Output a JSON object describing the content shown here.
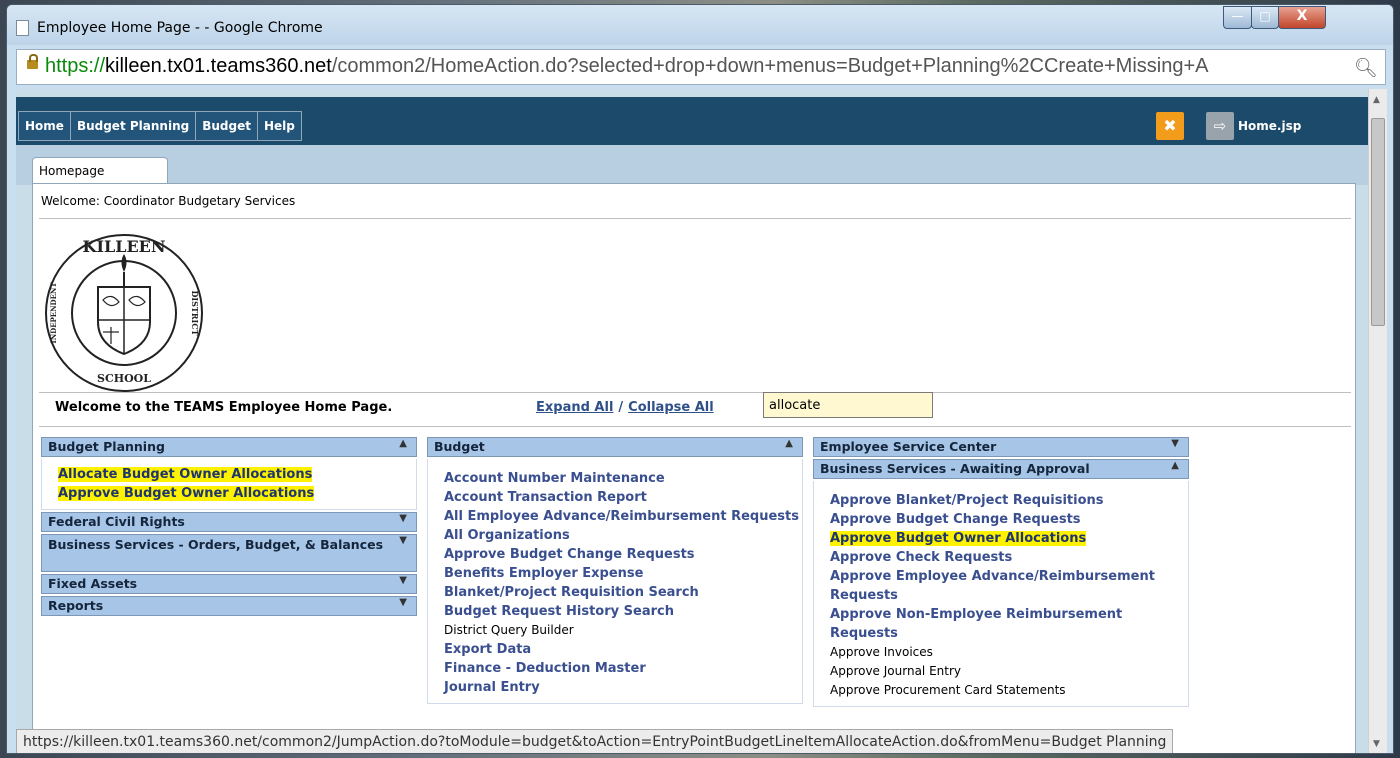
{
  "window": {
    "title": "Employee Home Page - - Google Chrome",
    "minimize": "—",
    "maximize": "□",
    "close": "X"
  },
  "address": {
    "scheme": "https://",
    "host": "killeen.tx01.teams360.net",
    "path": "/common2/HomeAction.do?selected+drop+down+menus=Budget+Planning%2CCreate+Missing+A"
  },
  "nav": {
    "menu": [
      "Home",
      "Budget Planning",
      "Budget",
      "Help"
    ],
    "close_glyph": "✖",
    "exit_glyph": "⇨",
    "page_name": "Home.jsp"
  },
  "tab": {
    "label": "Homepage"
  },
  "page": {
    "welcome": "Welcome: Coordinator Budgetary Services",
    "lead": "Welcome to the TEAMS Employee Home Page.",
    "expand_all": "Expand All",
    "separator": "/",
    "collapse_all": "Collapse All",
    "filter_value": "allocate"
  },
  "columns": [
    {
      "sections": [
        {
          "title": "Budget Planning",
          "expanded": true,
          "items": [
            {
              "label": "Allocate Budget Owner Allocations",
              "highlight": true
            },
            {
              "label": "Approve Budget Owner Allocations",
              "highlight": true
            }
          ]
        },
        {
          "title": "Federal Civil Rights",
          "expanded": false
        },
        {
          "title": "Business Services - Orders, Budget, & Balances",
          "expanded": false
        },
        {
          "title": "Fixed Assets",
          "expanded": false
        },
        {
          "title": "Reports",
          "expanded": false
        }
      ]
    },
    {
      "sections": [
        {
          "title": "Budget",
          "expanded": true,
          "items": [
            {
              "label": "Account Number Maintenance"
            },
            {
              "label": "Account Transaction Report"
            },
            {
              "label": "All Employee Advance/Reimbursement Requests"
            },
            {
              "label": "All Organizations"
            },
            {
              "label": "Approve Budget Change Requests"
            },
            {
              "label": "Benefits Employer Expense"
            },
            {
              "label": "Blanket/Project Requisition Search"
            },
            {
              "label": "Budget Request History Search"
            },
            {
              "label": "District Query Builder",
              "plain": true
            },
            {
              "label": "Export Data"
            },
            {
              "label": "Finance - Deduction Master"
            },
            {
              "label": "Journal Entry"
            }
          ]
        }
      ]
    },
    {
      "sections": [
        {
          "title": "Employee Service Center",
          "expanded": false
        },
        {
          "title": "Business Services - Awaiting Approval",
          "expanded": true,
          "items": [
            {
              "label": "Approve Blanket/Project Requisitions"
            },
            {
              "label": "Approve Budget Change Requests"
            },
            {
              "label": "Approve Budget Owner Allocations",
              "highlight": true
            },
            {
              "label": "Approve Check Requests"
            },
            {
              "label": "Approve Employee Advance/Reimbursement Requests"
            },
            {
              "label": "Approve Non-Employee Reimbursement Requests"
            },
            {
              "label": "Approve Invoices",
              "plain": true
            },
            {
              "label": "Approve Journal Entry",
              "plain": true
            },
            {
              "label": "Approve Procurement Card Statements",
              "plain": true
            }
          ]
        }
      ]
    }
  ],
  "logo": {
    "top_text": "KILLEEN",
    "left_text": "INDEPENDENT",
    "right_text": "DISTRICT",
    "bottom_text": "SCHOOL"
  },
  "status_bar": "https://killeen.tx01.teams360.net/common2/JumpAction.do?toModule=budget&toAction=EntryPointBudgetLineItemAllocateAction.do&fromMenu=Budget Planning",
  "colors": {
    "nav": "#1c4a6a",
    "section_header": "#a7c5e6",
    "highlight": "#fff200",
    "link": "#3a4f8f",
    "orange_button": "#f39b1b"
  }
}
